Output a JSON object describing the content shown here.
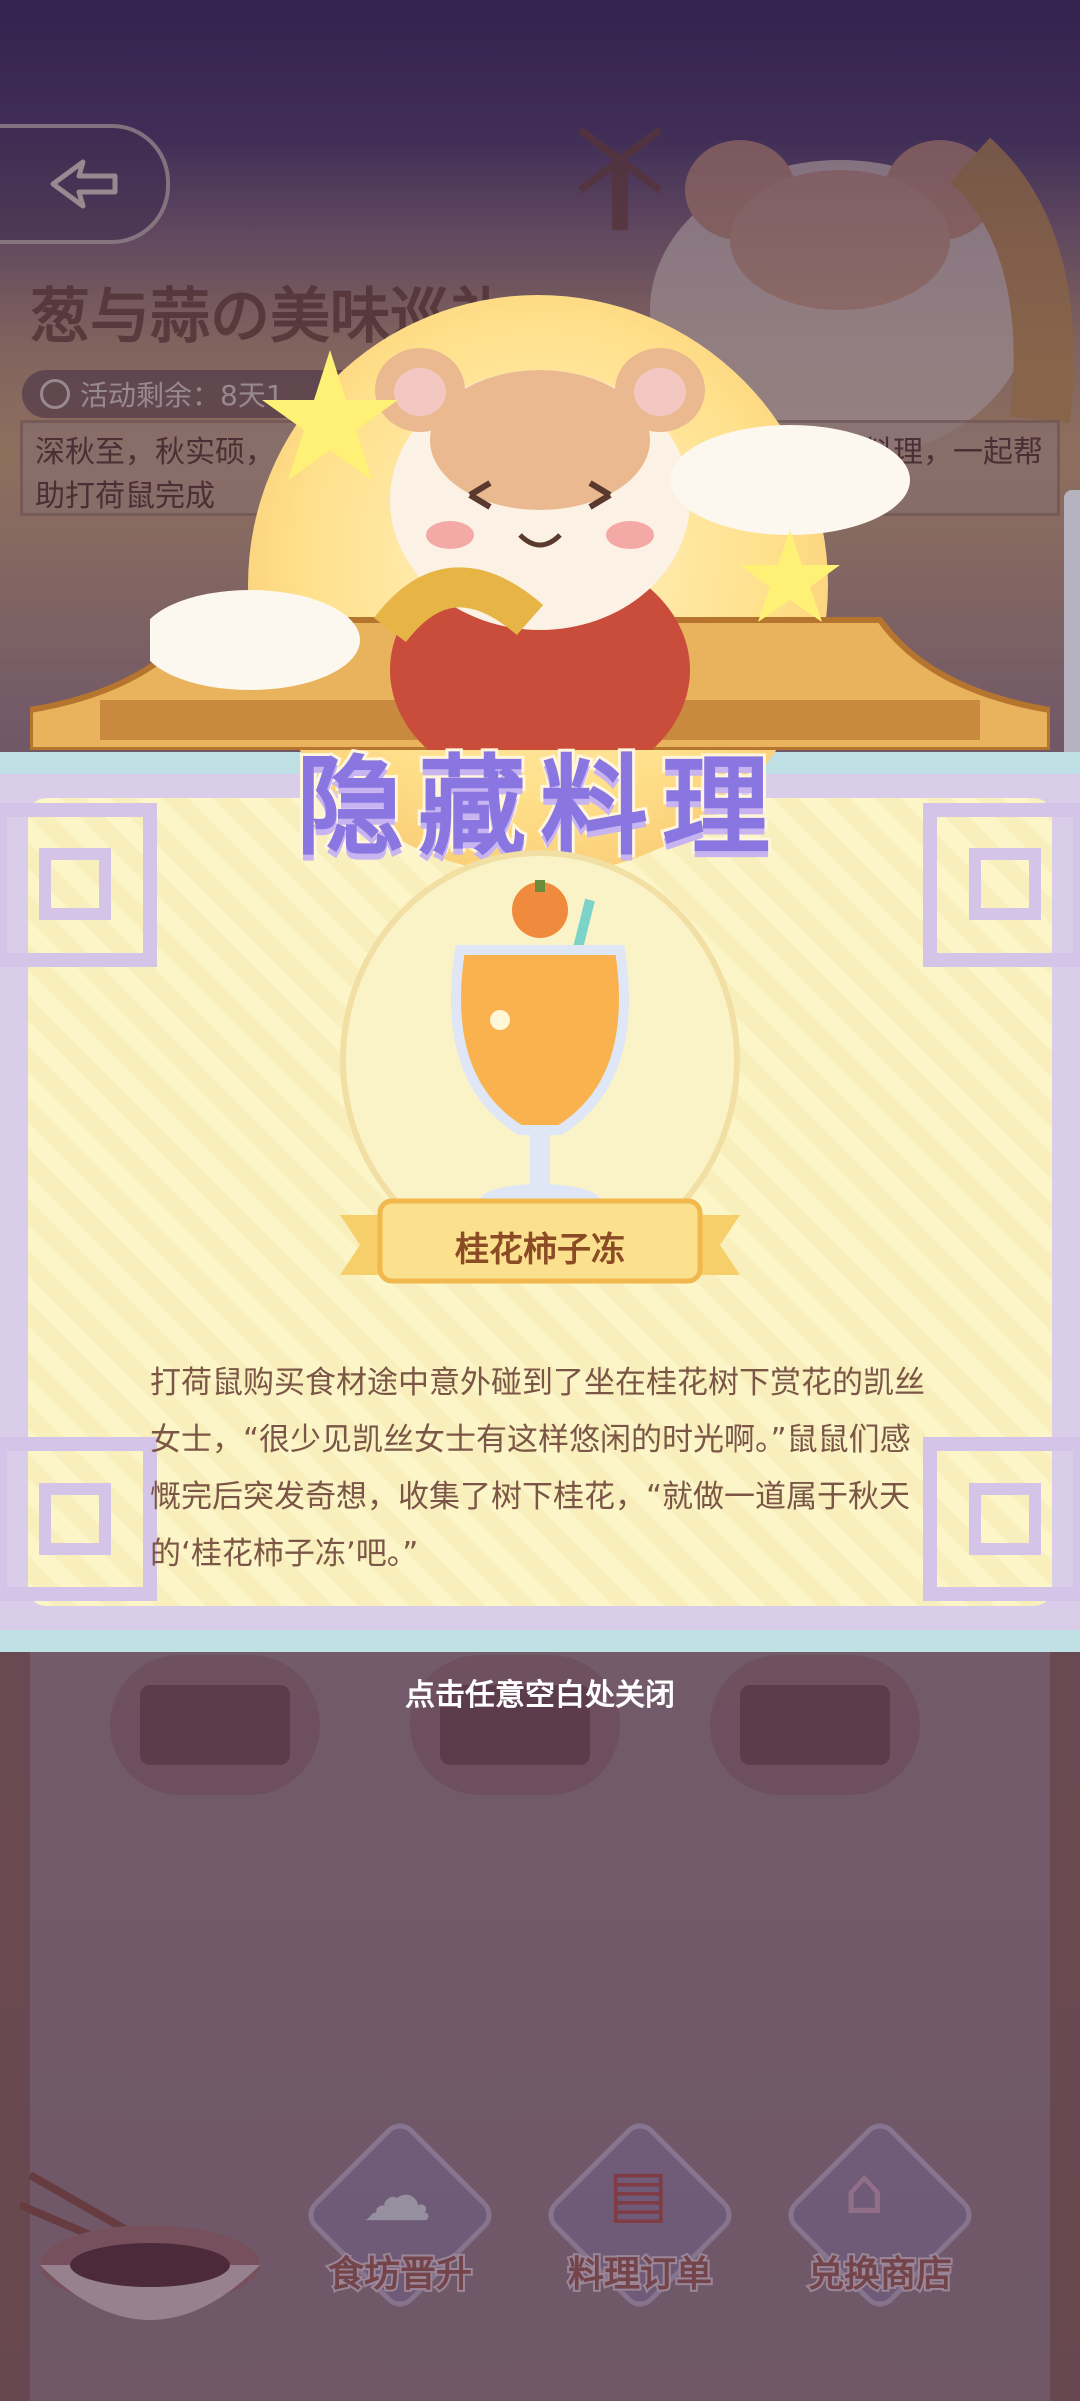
{
  "background": {
    "event_title": "葱与蒜の美味巡礼",
    "timer_label": "活动剩余：8天1",
    "intro_text_left": "深秋至，秋实硕，",
    "intro_text_right": "料理，一起帮",
    "intro_text_line2": "助打荷鼠完成"
  },
  "modal": {
    "title": "隐藏料理",
    "dish_name": "桂花柿子冻",
    "description": "打荷鼠购买食材途中意外碰到了坐在桂花树下赏花的凯丝女士，“很少见凯丝女士有这样悠闲的时光啊。”鼠鼠们感慨完后突发奇想，收集了树下桂花，“就做一道属于秋天的‘桂花柿子冻’吧。”",
    "close_hint": "点击任意空白处关闭"
  },
  "bottom_nav": [
    {
      "label": "食坊晋升",
      "icon": "chef-hat-icon"
    },
    {
      "label": "料理订单",
      "icon": "order-clipboard-icon"
    },
    {
      "label": "兑换商店",
      "icon": "shop-icon"
    }
  ],
  "colors": {
    "title_purple": "#8a76e0",
    "modal_frame": "#d9cdea",
    "paper": "#fbf5c8",
    "desc_text": "#7b5646"
  }
}
